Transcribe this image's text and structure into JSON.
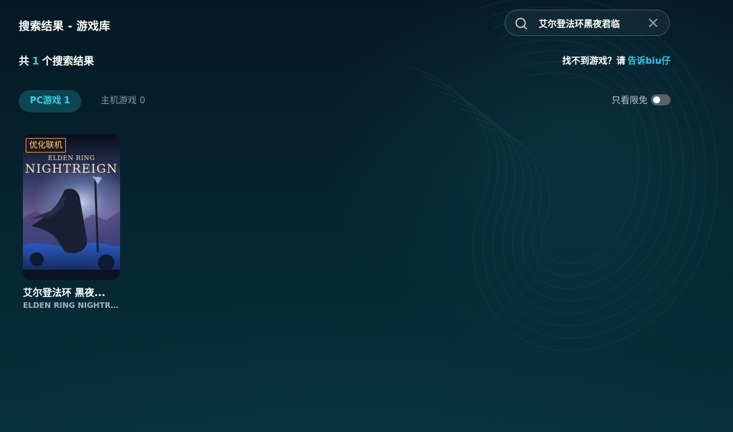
{
  "header": {
    "title": "搜索结果 - 游戏库"
  },
  "search": {
    "value": "艾尔登法环黑夜君临",
    "placeholder": ""
  },
  "results": {
    "prefix": "共",
    "count": "1",
    "suffix": "个搜索结果"
  },
  "feedback": {
    "text": "找不到游戏？请",
    "link": "告诉biu仔"
  },
  "tabs": [
    {
      "label": "PC游戏",
      "count": "1",
      "active": true
    },
    {
      "label": "主机游戏",
      "count": "0",
      "active": false
    }
  ],
  "filter": {
    "free_label": "只看限免",
    "free_only": false
  },
  "games": [
    {
      "name": "艾尔登法环 黑夜...",
      "subname": "ELDEN RING NIGHTRE...",
      "tag": "优化联机",
      "cover_text_small": "ELDEN RING",
      "cover_text_big": "NIGHTREIGN"
    }
  ],
  "colors": {
    "accent": "#2ec8e6",
    "active_tab_bg": "#0e4552",
    "background": "#062330"
  }
}
